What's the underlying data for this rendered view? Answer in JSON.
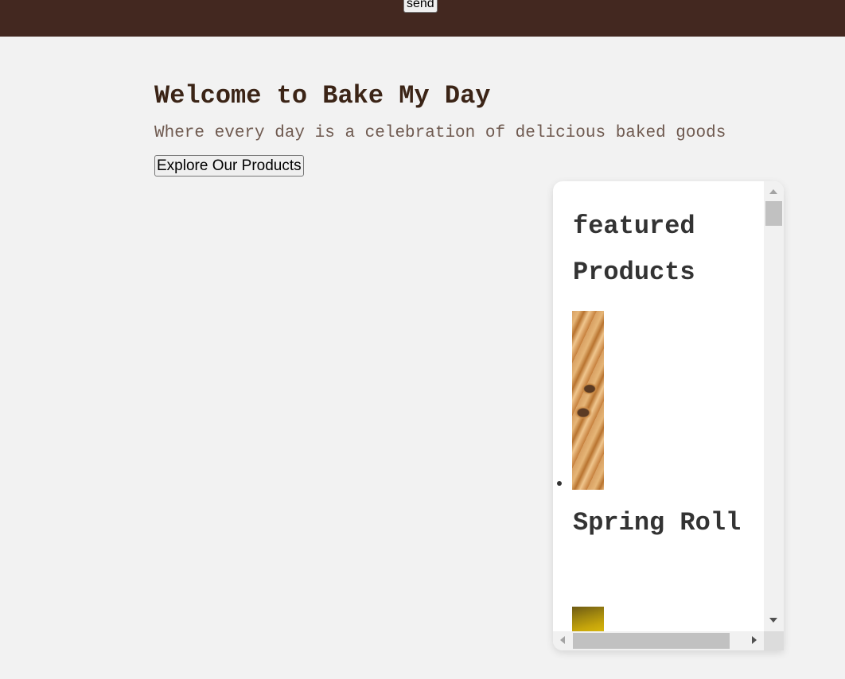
{
  "header": {
    "send_label": "send",
    "bg_color": "#432820"
  },
  "hero": {
    "title": "Welcome to Bake My Day",
    "subtitle": "Where every day is a celebration of delicious baked goods",
    "cta_label": "Explore Our Products"
  },
  "featured": {
    "title": "featured Products",
    "products": [
      {
        "name": "Spring Roll",
        "image": "spring-roll-photo"
      },
      {
        "name": "",
        "image": "product-photo"
      }
    ]
  },
  "colors": {
    "page_bg": "#f2f2f2",
    "title_color": "#3b2416",
    "subtitle_color": "#6f5a50"
  }
}
